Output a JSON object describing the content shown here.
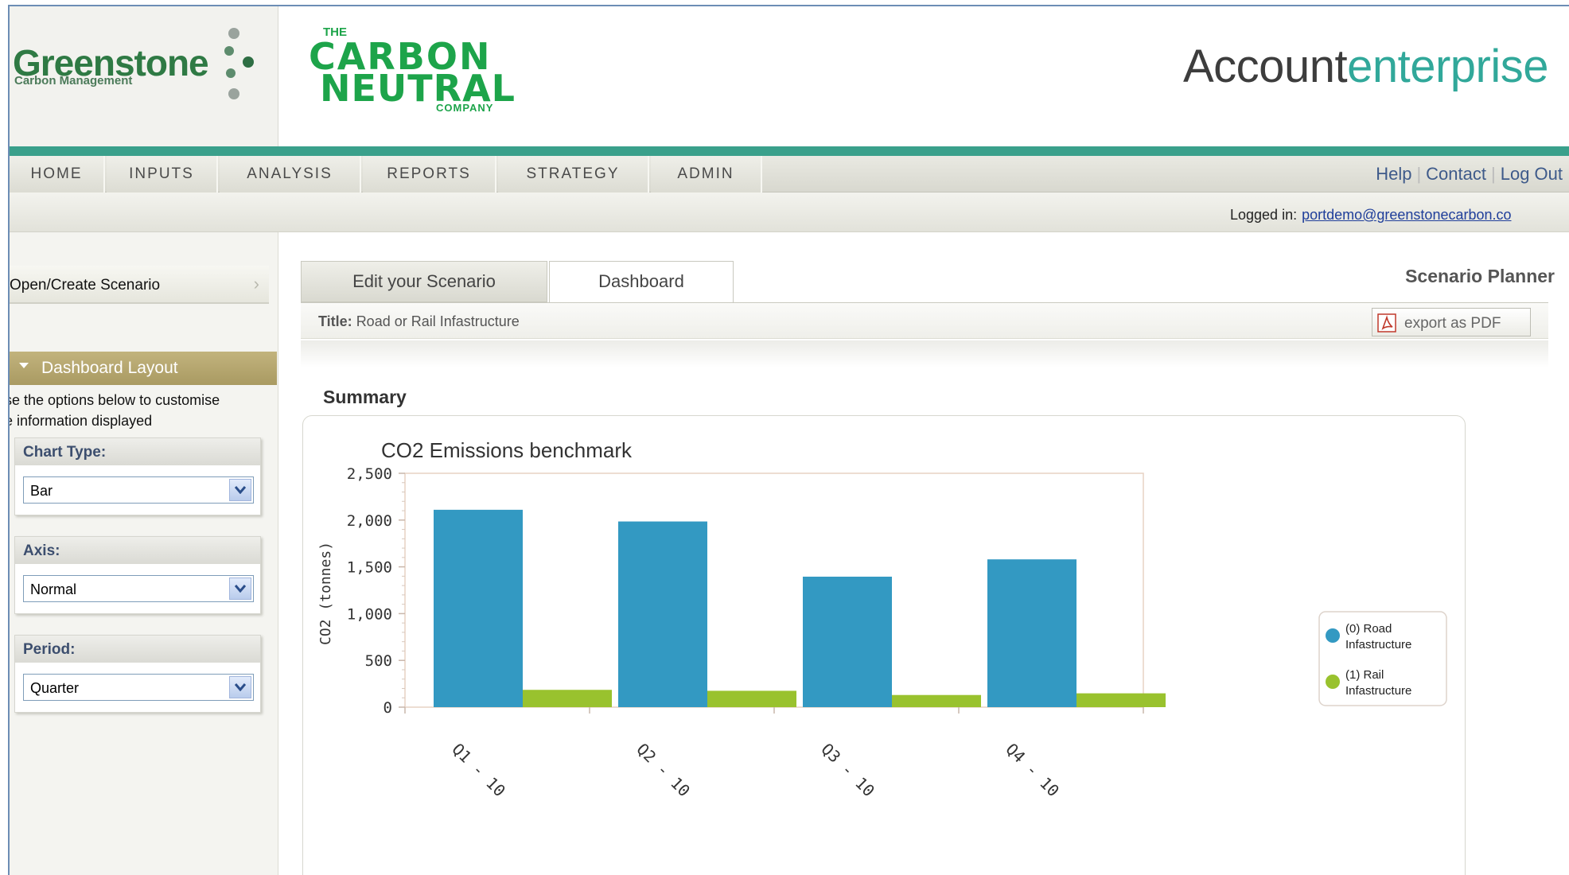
{
  "header": {
    "greenstone_name": "Greenstone",
    "greenstone_sub": "Carbon Management",
    "cn_the": "THE",
    "cn_carbon": "CARBON",
    "cn_neutral": "NEUTRAL",
    "cn_company": "COMPANY",
    "brand_part1": "Acco",
    "brand_part2": "unt",
    "brand_part3": "enterprise"
  },
  "nav": {
    "items": [
      "HOME",
      "INPUTS",
      "ANALYSIS",
      "REPORTS",
      "STRATEGY",
      "ADMIN"
    ],
    "help": "Help",
    "contact": "Contact",
    "logout": "Log Out",
    "logged_in_label": "Logged in:",
    "logged_in_email": "portdemo@greenstonecarbon.co"
  },
  "sidebar": {
    "open_create": "Open/Create Scenario",
    "dashboard_layout": "Dashboard Layout",
    "description_line1": "se the options below to customise",
    "description_line2": "e information displayed",
    "chart_type_label": "Chart Type:",
    "chart_type_value": "Bar",
    "axis_label": "Axis:",
    "axis_value": "Normal",
    "period_label": "Period:",
    "period_value": "Quarter"
  },
  "main": {
    "tab_edit": "Edit your Scenario",
    "tab_dashboard": "Dashboard",
    "scenario_planner": "Scenario Planner",
    "title_prefix": "Title:",
    "title_value": "Road or Rail Infastructure",
    "export_pdf": "export as PDF",
    "summary": "Summary"
  },
  "colors": {
    "road": "#3399c2",
    "rail": "#99c22e",
    "teal": "#3aa08b"
  },
  "chart_data": {
    "type": "bar",
    "title": "CO2 Emissions benchmark",
    "ylabel": "CO2 (tonnes)",
    "xlabel": "",
    "categories": [
      "Q1 - 10",
      "Q2 - 10",
      "Q3 - 10",
      "Q4 - 10"
    ],
    "ylim": [
      0,
      2500
    ],
    "yticks": [
      "0",
      "500",
      "1,000",
      "1,500",
      "2,000",
      "2,500"
    ],
    "series": [
      {
        "name": "(0) Road Infastructure",
        "values": [
          2110,
          1985,
          1395,
          1580
        ]
      },
      {
        "name": "(1) Rail Infastructure",
        "values": [
          185,
          175,
          130,
          148
        ]
      }
    ],
    "legend_position": "right",
    "grid": false
  }
}
